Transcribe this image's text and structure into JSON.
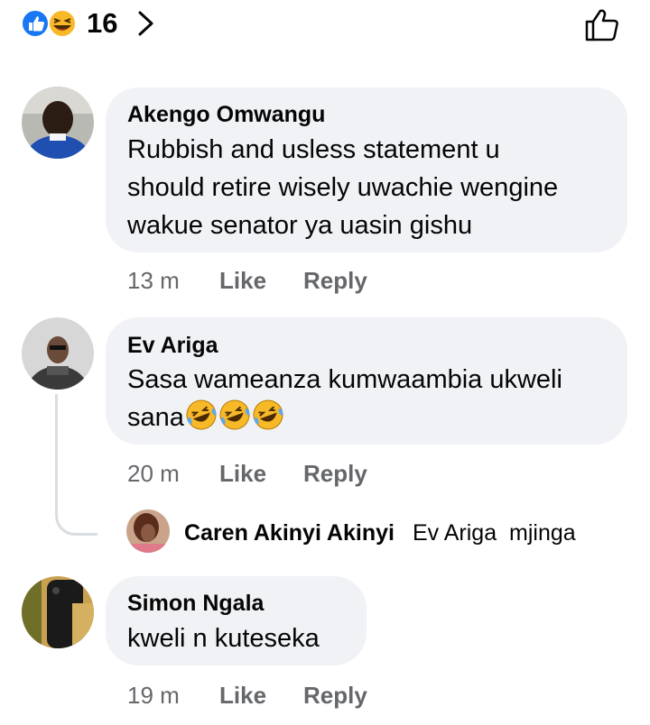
{
  "reactions": {
    "count": "16",
    "icons": [
      "like-reaction-icon",
      "haha-reaction-icon"
    ]
  },
  "comments": [
    {
      "author": "Akengo Omwangu",
      "text": "Rubbish and usless statement u should retire wisely uwachie wengine wakue senator ya uasin gishu",
      "lines": [
        "Rubbish and usless statement u",
        "should retire wisely uwachie wengine",
        "wakue senator ya uasin gishu"
      ],
      "time": "13 m",
      "like_label": "Like",
      "reply_label": "Reply"
    },
    {
      "author": "Ev Ariga",
      "lines": [
        "Sasa wameanza kumwaambia ukweli",
        "sana"
      ],
      "emojis": [
        "laughing-tears-emoji",
        "laughing-tears-emoji",
        "laughing-tears-emoji"
      ],
      "time": "20 m",
      "like_label": "Like",
      "reply_label": "Reply",
      "reply": {
        "author": "Caren Akinyi Akinyi",
        "mention": "Ev Ariga",
        "text": "mjinga"
      }
    },
    {
      "author": "Simon Ngala",
      "text": "kweli n kuteseka",
      "time": "19 m",
      "like_label": "Like",
      "reply_label": "Reply"
    }
  ],
  "colors": {
    "bubble": "#f0f2f5",
    "meta_text": "#65676b",
    "like_blue": "#1877f2",
    "haha_yellow": "#f7b928"
  }
}
